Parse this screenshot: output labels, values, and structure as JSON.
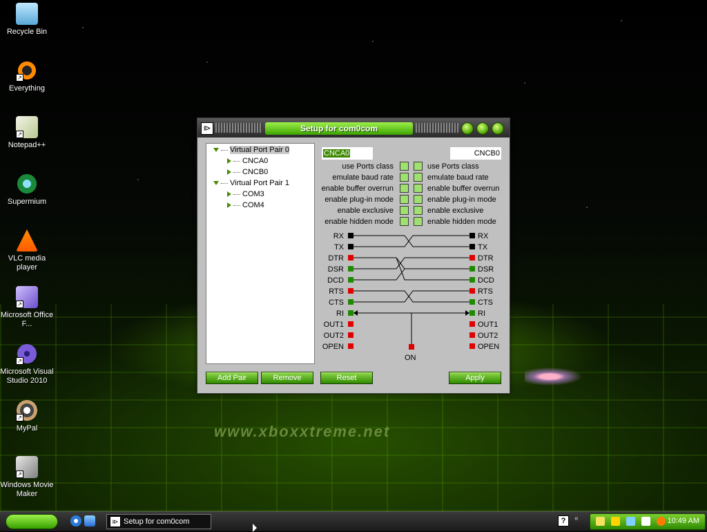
{
  "desktop": {
    "icons": [
      {
        "label": "Recycle Bin",
        "icon": "recycle-bin-icon"
      },
      {
        "label": "Everything",
        "icon": "everything-icon"
      },
      {
        "label": "Notepad++",
        "icon": "notepad-plus-plus-icon"
      },
      {
        "label": "Supermium",
        "icon": "supermium-icon"
      },
      {
        "label": "VLC media player",
        "icon": "vlc-icon"
      },
      {
        "label": "Microsoft Office F...",
        "icon": "office-icon"
      },
      {
        "label": "Microsoft Visual Studio 2010",
        "icon": "visual-studio-icon"
      },
      {
        "label": "MyPal",
        "icon": "mypal-icon"
      },
      {
        "label": "Windows Movie Maker",
        "icon": "movie-maker-icon"
      }
    ],
    "wallpaper_text": "www.xboxxtreme.net"
  },
  "window": {
    "title": "Setup for com0com",
    "tree": [
      {
        "label": "Virtual Port Pair 0",
        "expanded": true,
        "selected": true
      },
      {
        "label": "CNCA0"
      },
      {
        "label": "CNCB0"
      },
      {
        "label": "Virtual Port Pair 1",
        "expanded": true
      },
      {
        "label": "COM3"
      },
      {
        "label": "COM4"
      }
    ],
    "left_port": "CNCA0",
    "right_port": "CNCB0",
    "options": [
      "use Ports class",
      "emulate baud rate",
      "enable buffer overrun",
      "enable plug-in mode",
      "enable exclusive",
      "enable hidden mode"
    ],
    "signals_left": [
      "RX",
      "TX",
      "DTR",
      "DSR",
      "DCD",
      "RTS",
      "CTS",
      "RI",
      "OUT1",
      "OUT2",
      "OPEN"
    ],
    "signals_right": [
      "RX",
      "TX",
      "DTR",
      "DSR",
      "DCD",
      "RTS",
      "CTS",
      "RI",
      "OUT1",
      "OUT2",
      "OPEN"
    ],
    "on_label": "ON",
    "buttons": {
      "add_pair": "Add Pair",
      "remove": "Remove",
      "reset": "Reset",
      "apply": "Apply"
    },
    "colors": {
      "accent": "#3da400",
      "signal_on": "#1e8a00",
      "signal_off": "#e00000",
      "signal_black": "#000000"
    }
  },
  "taskbar": {
    "task_title": "Setup for com0com",
    "clock": "10:49 AM"
  }
}
